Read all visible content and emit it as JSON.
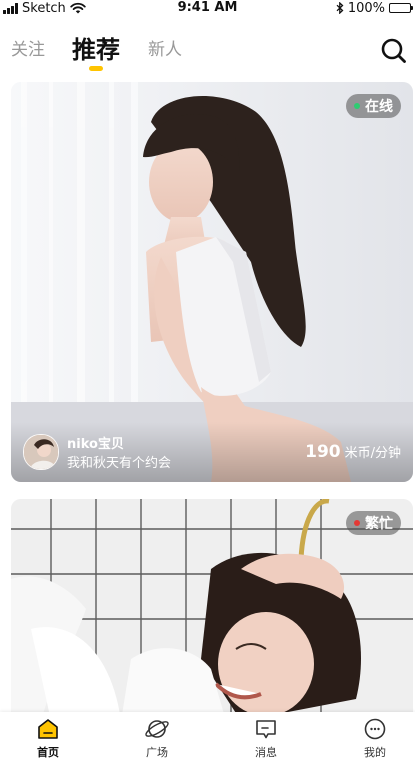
{
  "status_bar": {
    "carrier": "Sketch",
    "time": "9:41 AM",
    "battery": "100%"
  },
  "top_nav": {
    "tabs": [
      {
        "label": "关注"
      },
      {
        "label": "推荐"
      },
      {
        "label": "新人"
      }
    ],
    "active_tab": "推荐",
    "accent_color": "#FFC400"
  },
  "cards": [
    {
      "status": "在线",
      "status_color": "#2ECC71",
      "host_name": "niko宝贝",
      "host_subtitle": "我和秋天有个约会",
      "price_value": "190",
      "price_unit": "米币/分钟"
    },
    {
      "status": "繁忙",
      "status_color": "#E53935"
    }
  ],
  "bottom_nav": {
    "items": [
      {
        "label": "首页",
        "icon": "home-icon"
      },
      {
        "label": "广场",
        "icon": "planet-icon"
      },
      {
        "label": "消息",
        "icon": "message-icon"
      },
      {
        "label": "我的",
        "icon": "smiley-icon"
      }
    ],
    "active_index": 0
  }
}
